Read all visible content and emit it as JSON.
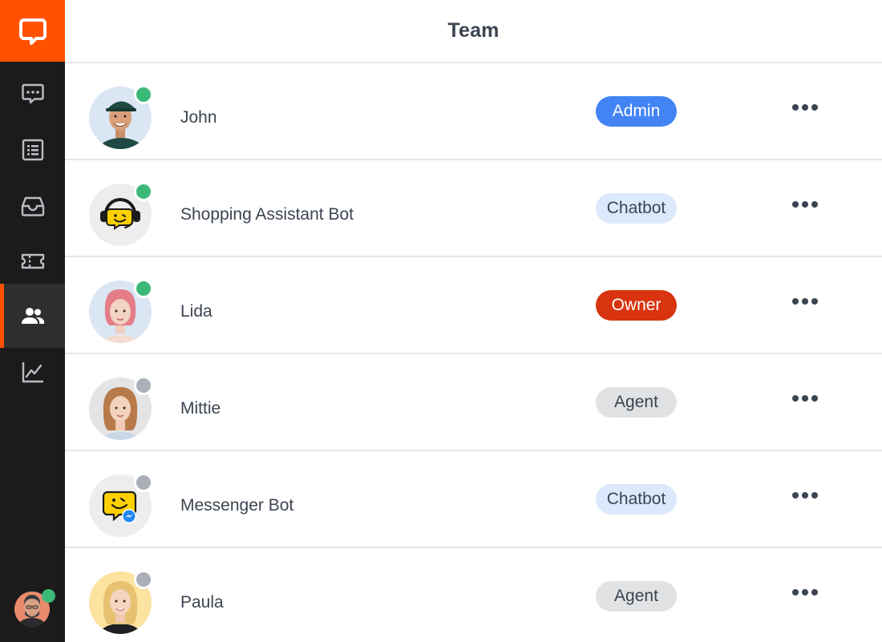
{
  "app": {
    "title": "Team",
    "brand_color": "#ff5100",
    "sidebar_bg": "#1b1b1c"
  },
  "sidebar": {
    "items": [
      {
        "name": "chats",
        "icon": "chat-dots-icon",
        "active": false
      },
      {
        "name": "archives",
        "icon": "list-icon",
        "active": false
      },
      {
        "name": "inbox",
        "icon": "inbox-tray-icon",
        "active": false
      },
      {
        "name": "tickets",
        "icon": "ticket-icon",
        "active": false
      },
      {
        "name": "team",
        "icon": "team-people-icon",
        "active": true
      },
      {
        "name": "reports",
        "icon": "line-chart-icon",
        "active": false
      }
    ],
    "user_status_color": "#3cb878"
  },
  "team": {
    "members": [
      {
        "name": "John",
        "role": "Admin",
        "status": "online",
        "avatar": "person-avatar"
      },
      {
        "name": "Shopping Assistant Bot",
        "role": "Chatbot",
        "status": "online",
        "avatar": "headset-bot-avatar"
      },
      {
        "name": "Lida",
        "role": "Owner",
        "status": "online",
        "avatar": "person-avatar"
      },
      {
        "name": "Mittie",
        "role": "Agent",
        "status": "offline",
        "avatar": "person-avatar"
      },
      {
        "name": "Messenger Bot",
        "role": "Chatbot",
        "status": "offline",
        "avatar": "messenger-bot-avatar"
      },
      {
        "name": "Paula",
        "role": "Agent",
        "status": "offline",
        "avatar": "person-avatar"
      }
    ]
  },
  "colors": {
    "online": "#3cb878",
    "offline": "#aab0b8",
    "admin_bg": "#4384f5",
    "admin_text": "#ffffff",
    "chatbot_bg": "#dce8fb",
    "chatbot_text": "#3b4451",
    "owner_bg": "#d93410",
    "owner_text": "#ffffff",
    "agent_bg": "#e1e2e4",
    "agent_text": "#3b4451"
  }
}
